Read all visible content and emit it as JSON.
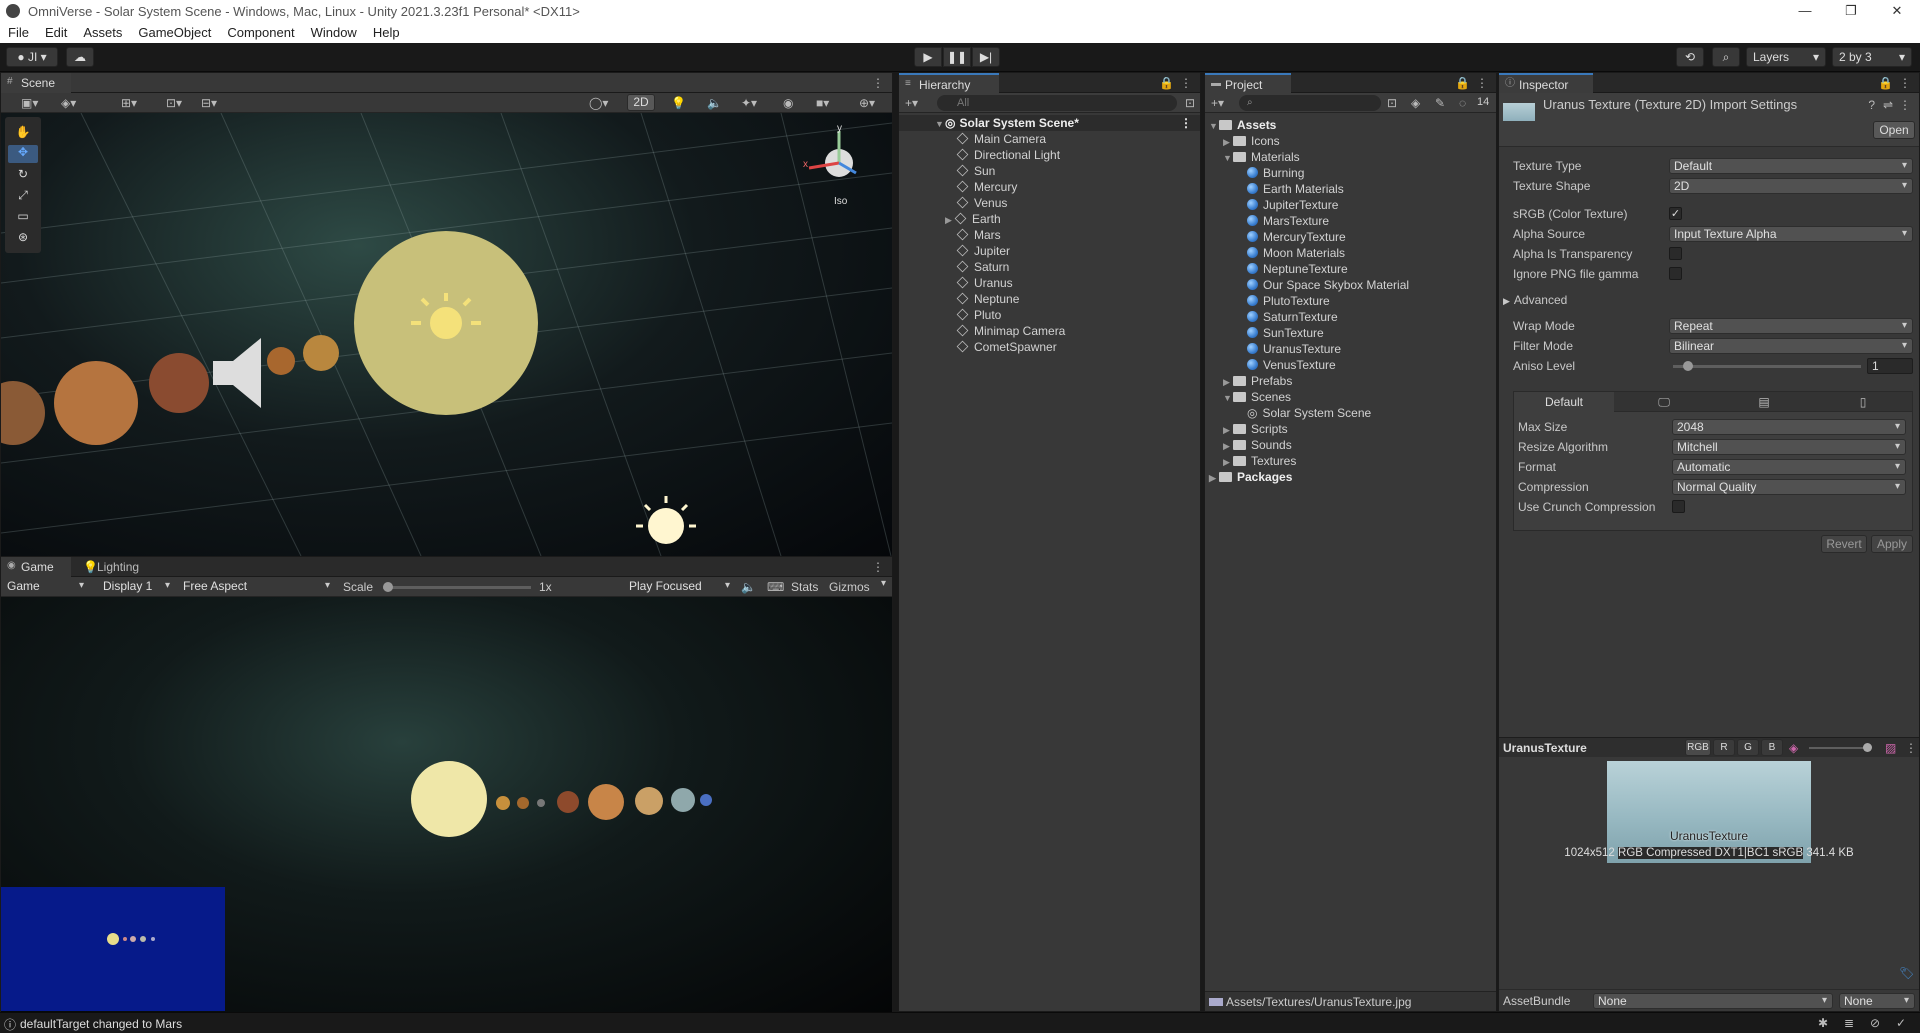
{
  "window": {
    "title": "OmniVerse - Solar System Scene - Windows, Mac, Linux - Unity 2021.3.23f1 Personal* <DX11>",
    "min": "—",
    "max": "❐",
    "close": "✕"
  },
  "menu": [
    "File",
    "Edit",
    "Assets",
    "GameObject",
    "Component",
    "Window",
    "Help"
  ],
  "toolbar": {
    "account": "JI",
    "layers": "Layers",
    "layout": "2 by 3"
  },
  "scene": {
    "tab": "Scene",
    "mode_2d": "2D",
    "gizmo_label": "Iso",
    "gizmo_y": "y",
    "gizmo_x": "x"
  },
  "game": {
    "tab": "Game",
    "tab2": "Lighting",
    "view": "Game",
    "display": "Display 1",
    "aspect": "Free Aspect",
    "scale_label": "Scale",
    "scale_value": "1x",
    "play_mode": "Play Focused",
    "stats": "Stats",
    "gizmos": "Gizmos"
  },
  "hierarchy": {
    "tab": "Hierarchy",
    "search_placeholder": "All",
    "root": "Solar System Scene*",
    "items": [
      "Main Camera",
      "Directional Light",
      "Sun",
      "Mercury",
      "Venus",
      "Earth",
      "Mars",
      "Jupiter",
      "Saturn",
      "Uranus",
      "Neptune",
      "Pluto",
      "Minimap Camera",
      "CometSpawner"
    ]
  },
  "project": {
    "tab": "Project",
    "hidden_count": "14",
    "assets": "Assets",
    "icons": "Icons",
    "materials": "Materials",
    "material_items": [
      "Burning",
      "Earth Materials",
      "JupiterTexture",
      "MarsTexture",
      "MercuryTexture",
      "Moon Materials",
      "NeptuneTexture",
      "Our Space Skybox Material",
      "PlutoTexture",
      "SaturnTexture",
      "SunTexture",
      "UranusTexture",
      "VenusTexture"
    ],
    "prefabs": "Prefabs",
    "scenes": "Scenes",
    "scene_item": "Solar System Scene",
    "scripts": "Scripts",
    "sounds": "Sounds",
    "textures": "Textures",
    "packages": "Packages",
    "path": "Assets/Textures/UranusTexture.jpg"
  },
  "inspector": {
    "tab": "Inspector",
    "title": "Uranus Texture (Texture 2D) Import Settings",
    "open": "Open",
    "texture_type_label": "Texture Type",
    "texture_type": "Default",
    "texture_shape_label": "Texture Shape",
    "texture_shape": "2D",
    "srgb_label": "sRGB (Color Texture)",
    "alpha_source_label": "Alpha Source",
    "alpha_source": "Input Texture Alpha",
    "alpha_transp_label": "Alpha Is Transparency",
    "ignore_png_label": "Ignore PNG file gamma",
    "advanced": "Advanced",
    "wrap_label": "Wrap Mode",
    "wrap": "Repeat",
    "filter_label": "Filter Mode",
    "filter": "Bilinear",
    "aniso_label": "Aniso Level",
    "aniso": "1",
    "platform_default": "Default",
    "max_size_label": "Max Size",
    "max_size": "2048",
    "resize_label": "Resize Algorithm",
    "resize": "Mitchell",
    "format_label": "Format",
    "format": "Automatic",
    "compression_label": "Compression",
    "compression": "Normal Quality",
    "crunch_label": "Use Crunch Compression",
    "revert": "Revert",
    "apply": "Apply",
    "preview_name": "UranusTexture",
    "ch_rgb": "RGB",
    "ch_r": "R",
    "ch_g": "G",
    "ch_b": "B",
    "preview_overlay": "UranusTexture",
    "preview_info_size": "1024x512",
    "preview_info_fmt": "RGB Compressed DXT1|BC1 sRGB",
    "preview_info_kb": "341.4 KB",
    "assetbundle_label": "AssetBundle",
    "assetbundle": "None",
    "assetbundle_variant": "None"
  },
  "status": {
    "message": "defaultTarget changed to Mars"
  },
  "colors": {
    "accent": "#3a79bb",
    "panel": "#383838"
  }
}
